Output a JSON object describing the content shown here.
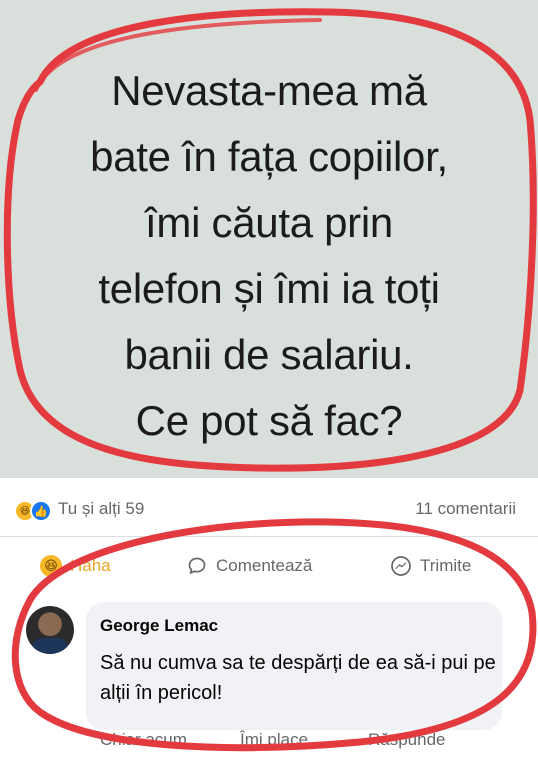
{
  "post": {
    "lines": [
      "Nevasta-mea mă",
      "bate în fața copiilor,",
      "îmi căuta prin",
      "telefon și îmi ia toți",
      "banii de salariu.",
      "Ce pot să fac?"
    ]
  },
  "reactions": {
    "summary": "Tu și alți 59",
    "comments": "11 comentarii",
    "icons": [
      "haha-icon",
      "like-icon"
    ]
  },
  "actions": {
    "haha": "Haha",
    "comment": "Comentează",
    "share": "Trimite"
  },
  "comment": {
    "author": "George Lemac",
    "text": "Să nu cumva sa te despărți de ea să-i pui pe alții în pericol!",
    "actions": [
      "Chiar acum",
      "Îmi place",
      "Răspunde"
    ]
  },
  "colors": {
    "annotation_red": "#e33a3f",
    "image_bg": "#d9dfda",
    "facebook_blue": "#1877f2",
    "secondary_text": "#65676b"
  }
}
